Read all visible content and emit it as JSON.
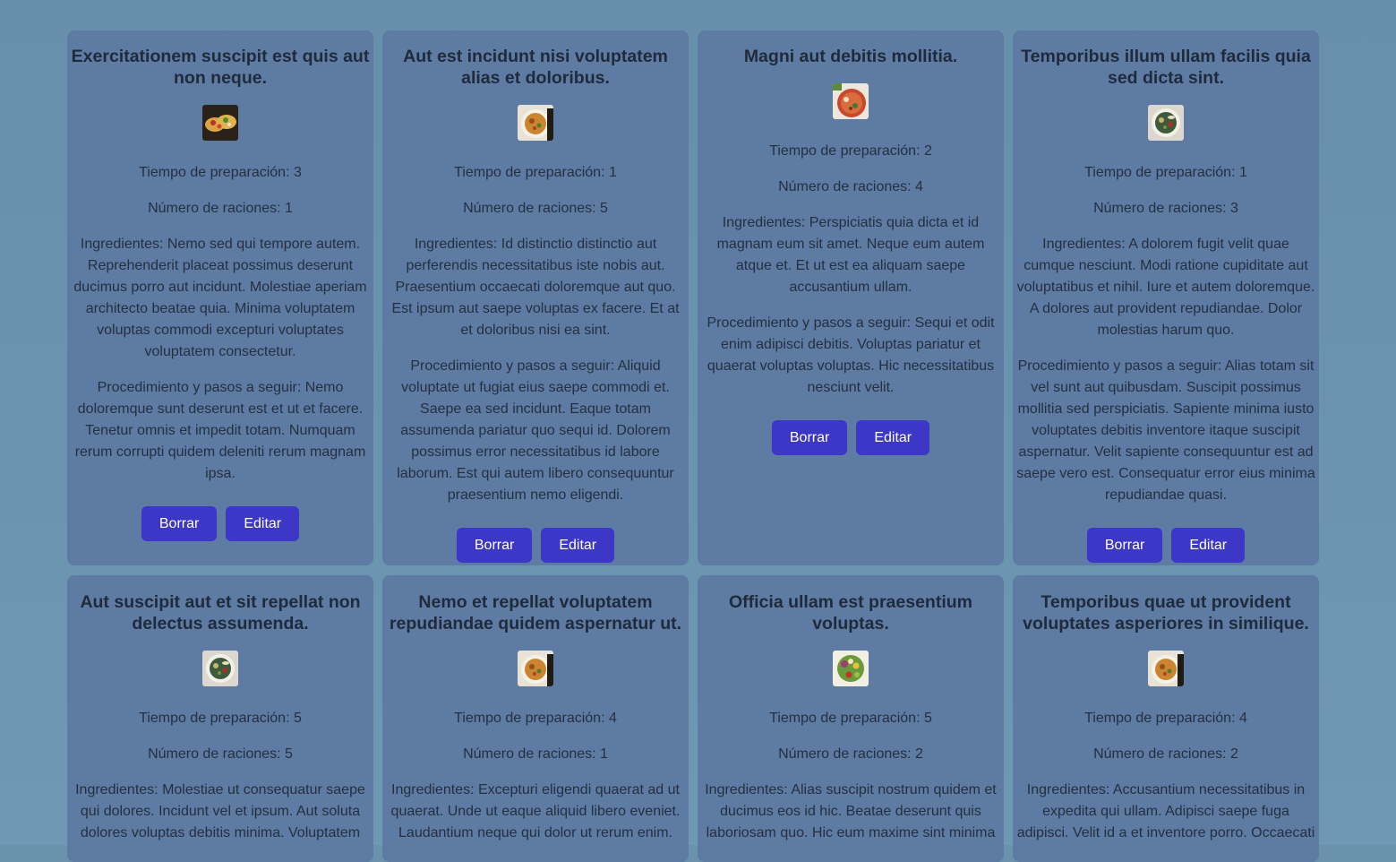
{
  "labels": {
    "prep_prefix": "Tiempo de preparación: ",
    "servings_prefix": "Número de raciones: ",
    "ingredients_prefix": "Ingredientes: ",
    "steps_prefix": "Procedimiento y pasos a seguir: ",
    "delete_button": "Borrar",
    "edit_button": "Editar"
  },
  "recipes": [
    {
      "title": "Exercitationem suscipit est quis aut non neque.",
      "image": "tacos",
      "prep": "3",
      "servings": "1",
      "ingredients": "Nemo sed qui tempore autem. Reprehenderit placeat possimus deserunt ducimus porro aut incidunt. Molestiae aperiam architecto beatae quia. Minima voluptatem voluptas commodi excepturi voluptates voluptatem consectetur.",
      "steps": "Nemo doloremque sunt deserunt est et ut et facere. Tenetur omnis et impedit totam. Numquam rerum corrupti quidem deleniti rerum magnam ipsa."
    },
    {
      "title": "Aut est incidunt nisi voluptatem alias et doloribus.",
      "image": "pasta",
      "prep": "1",
      "servings": "5",
      "ingredients": "Id distinctio distinctio aut perferendis necessitatibus iste nobis aut. Praesentium occaecati doloremque aut quo. Est ipsum aut saepe voluptas ex facere. Et at et doloribus nisi ea sint.",
      "steps": "Aliquid voluptate ut fugiat eius saepe commodi et. Saepe ea sed incidunt. Eaque totam assumenda pariatur quo sequi id. Dolorem possimus error necessitatibus id labore laborum. Est qui autem libero consequuntur praesentium nemo eligendi."
    },
    {
      "title": "Magni aut debitis mollitia.",
      "image": "pizza",
      "prep": "2",
      "servings": "4",
      "ingredients": "Perspiciatis quia dicta et id magnam eum sit amet. Neque eum autem atque et. Et ut est ea aliquam saepe accusantium ullam.",
      "steps": "Sequi et odit enim adipisci debitis. Voluptas pariatur et quaerat voluptas voluptas. Hic necessitatibus nesciunt velit."
    },
    {
      "title": "Temporibus illum ullam facilis quia sed dicta sint.",
      "image": "soup",
      "prep": "1",
      "servings": "3",
      "ingredients": "A dolorem fugit velit quae cumque nesciunt. Modi ratione cupiditate aut voluptatibus et nihil. Iure et autem doloremque. A dolores aut provident repudiandae. Dolor molestias harum quo.",
      "steps": "Alias totam sit vel sunt aut quibusdam. Suscipit possimus mollitia sed perspiciatis. Sapiente minima iusto voluptates debitis inventore itaque suscipit aspernatur. Velit sapiente consequuntur est ad saepe vero est. Consequatur error eius minima repudiandae quasi."
    },
    {
      "title": "Aut suscipit aut et sit repellat non delectus assumenda.",
      "image": "soup",
      "prep": "5",
      "servings": "5",
      "ingredients": "Molestiae ut consequatur saepe qui dolores. Incidunt vel et ipsum. Aut soluta dolores voluptas debitis minima. Voluptatem",
      "steps": ""
    },
    {
      "title": "Nemo et repellat voluptatem repudiandae quidem aspernatur ut.",
      "image": "pasta",
      "prep": "4",
      "servings": "1",
      "ingredients": "Excepturi eligendi quaerat ad ut quaerat. Unde ut eaque aliquid libero eveniet. Laudantium neque qui dolor ut rerum enim.",
      "steps": ""
    },
    {
      "title": "Officia ullam est praesentium voluptas.",
      "image": "salad",
      "prep": "5",
      "servings": "2",
      "ingredients": "Alias suscipit nostrum quidem et ducimus eos id hic. Beatae deserunt quis laboriosam quo. Hic eum maxime sint minima",
      "steps": ""
    },
    {
      "title": "Temporibus quae ut provident voluptates asperiores in similique.",
      "image": "pasta",
      "prep": "4",
      "servings": "2",
      "ingredients": "Accusantium necessitatibus in expedita qui ullam. Adipisci saepe fuga adipisci. Velit id a et inventore porro. Occaecati",
      "steps": ""
    }
  ]
}
